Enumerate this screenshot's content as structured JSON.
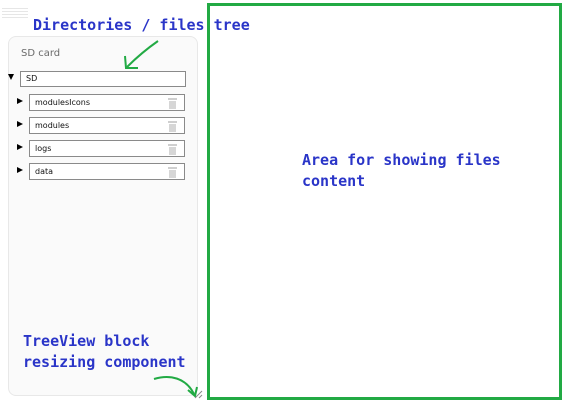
{
  "annotations": {
    "tree_label": "Directories / files tree",
    "content_label": "Area for showing files content",
    "resize_label": "TreeView block resizing component"
  },
  "tree": {
    "title": "SD card",
    "root": {
      "label": "SD",
      "expanded": true
    },
    "items": [
      {
        "label": "modulesIcons",
        "expanded": false
      },
      {
        "label": "modules",
        "expanded": false
      },
      {
        "label": "logs",
        "expanded": false
      },
      {
        "label": "data",
        "expanded": false
      }
    ]
  },
  "colors": {
    "annotation_text": "#2a35c8",
    "annotation_arrow": "#22aa44",
    "content_border": "#22aa44"
  },
  "icons": {
    "item_action": "trash-icon",
    "collapsed": "caret-right-icon",
    "expanded": "caret-down-icon",
    "resize": "resize-grip-icon"
  }
}
